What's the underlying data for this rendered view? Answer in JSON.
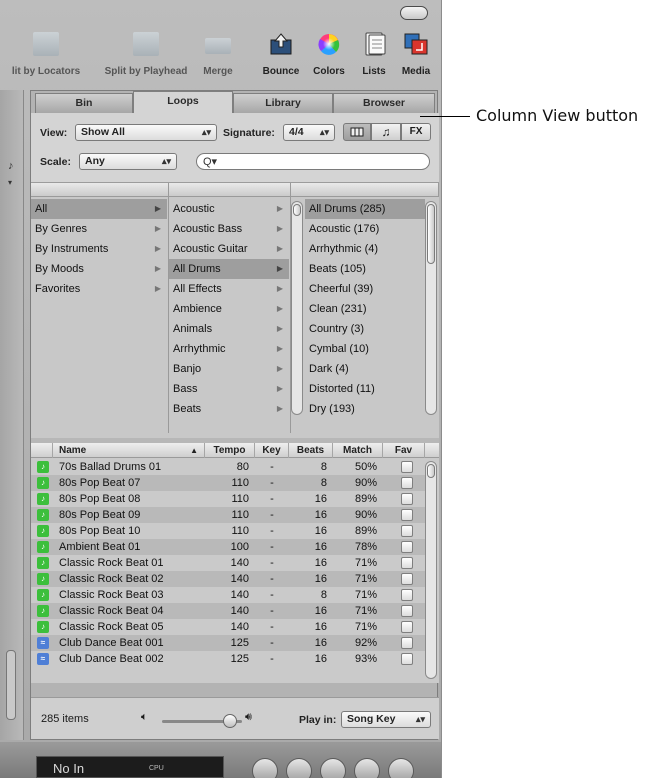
{
  "toolbar": {
    "items": [
      {
        "label": "lit by Locators",
        "icon": "split-locators-icon"
      },
      {
        "label": "Split by Playhead",
        "icon": "split-playhead-icon"
      },
      {
        "label": "Merge",
        "icon": "merge-icon"
      },
      {
        "label": "Bounce",
        "icon": "bounce-icon"
      },
      {
        "label": "Colors",
        "icon": "colors-icon"
      },
      {
        "label": "Lists",
        "icon": "lists-icon"
      },
      {
        "label": "Media",
        "icon": "media-icon"
      }
    ]
  },
  "tabs": [
    "Bin",
    "Loops",
    "Library",
    "Browser"
  ],
  "active_tab": "Loops",
  "controls": {
    "view_label": "View:",
    "view_value": "Show All",
    "signature_label": "Signature:",
    "signature_value": "4/4",
    "scale_label": "Scale:",
    "scale_value": "Any",
    "search_glyph": "Q▾",
    "view_buttons": [
      "column-view-icon",
      "note-icon",
      "fx-icon"
    ],
    "view_button_labels": [
      "",
      "♫",
      "FX"
    ]
  },
  "columns": {
    "col1": [
      "All",
      "By Genres",
      "By Instruments",
      "By Moods",
      "Favorites"
    ],
    "col1_selected": "All",
    "col2": [
      "Acoustic",
      "Acoustic Bass",
      "Acoustic Guitar",
      "All Drums",
      "All Effects",
      "Ambience",
      "Animals",
      "Arrhythmic",
      "Banjo",
      "Bass",
      "Beats"
    ],
    "col2_selected": "All Drums",
    "col3": [
      "All Drums (285)",
      "Acoustic (176)",
      "Arrhythmic (4)",
      "Beats (105)",
      "Cheerful (39)",
      "Clean (231)",
      "Country (3)",
      "Cymbal (10)",
      "Dark (4)",
      "Distorted (11)",
      "Dry (193)"
    ],
    "col3_selected": "All Drums (285)"
  },
  "table": {
    "headers": [
      "Name",
      "Tempo",
      "Key",
      "Beats",
      "Match",
      "Fav"
    ],
    "sort_indicator": "▲",
    "rows": [
      {
        "type": "green",
        "name": "70s Ballad Drums 01",
        "tempo": "80",
        "key": "-",
        "beats": "8",
        "match": "50%"
      },
      {
        "type": "green",
        "name": "80s Pop Beat 07",
        "tempo": "110",
        "key": "-",
        "beats": "8",
        "match": "90%"
      },
      {
        "type": "green",
        "name": "80s Pop Beat 08",
        "tempo": "110",
        "key": "-",
        "beats": "16",
        "match": "89%"
      },
      {
        "type": "green",
        "name": "80s Pop Beat 09",
        "tempo": "110",
        "key": "-",
        "beats": "16",
        "match": "90%"
      },
      {
        "type": "green",
        "name": "80s Pop Beat 10",
        "tempo": "110",
        "key": "-",
        "beats": "16",
        "match": "89%"
      },
      {
        "type": "green",
        "name": "Ambient Beat 01",
        "tempo": "100",
        "key": "-",
        "beats": "16",
        "match": "78%"
      },
      {
        "type": "green",
        "name": "Classic Rock Beat 01",
        "tempo": "140",
        "key": "-",
        "beats": "16",
        "match": "71%"
      },
      {
        "type": "green",
        "name": "Classic Rock Beat 02",
        "tempo": "140",
        "key": "-",
        "beats": "16",
        "match": "71%"
      },
      {
        "type": "green",
        "name": "Classic Rock Beat 03",
        "tempo": "140",
        "key": "-",
        "beats": "8",
        "match": "71%"
      },
      {
        "type": "green",
        "name": "Classic Rock Beat 04",
        "tempo": "140",
        "key": "-",
        "beats": "16",
        "match": "71%"
      },
      {
        "type": "green",
        "name": "Classic Rock Beat 05",
        "tempo": "140",
        "key": "-",
        "beats": "16",
        "match": "71%"
      },
      {
        "type": "blue",
        "name": "Club Dance Beat 001",
        "tempo": "125",
        "key": "-",
        "beats": "16",
        "match": "92%"
      },
      {
        "type": "blue",
        "name": "Club Dance Beat 002",
        "tempo": "125",
        "key": "-",
        "beats": "16",
        "match": "93%"
      }
    ]
  },
  "footer": {
    "item_count": "285 items",
    "play_in_label": "Play in:",
    "play_in_value": "Song Key"
  },
  "bottom": {
    "lcd_text": "No In",
    "cpu_label": "CPU"
  },
  "callout": "Column View button",
  "colors": {
    "apple_loop_green": "#3cbf3c",
    "software_loop_blue": "#4f7fd6",
    "selection_gray": "#9e9e9e"
  }
}
